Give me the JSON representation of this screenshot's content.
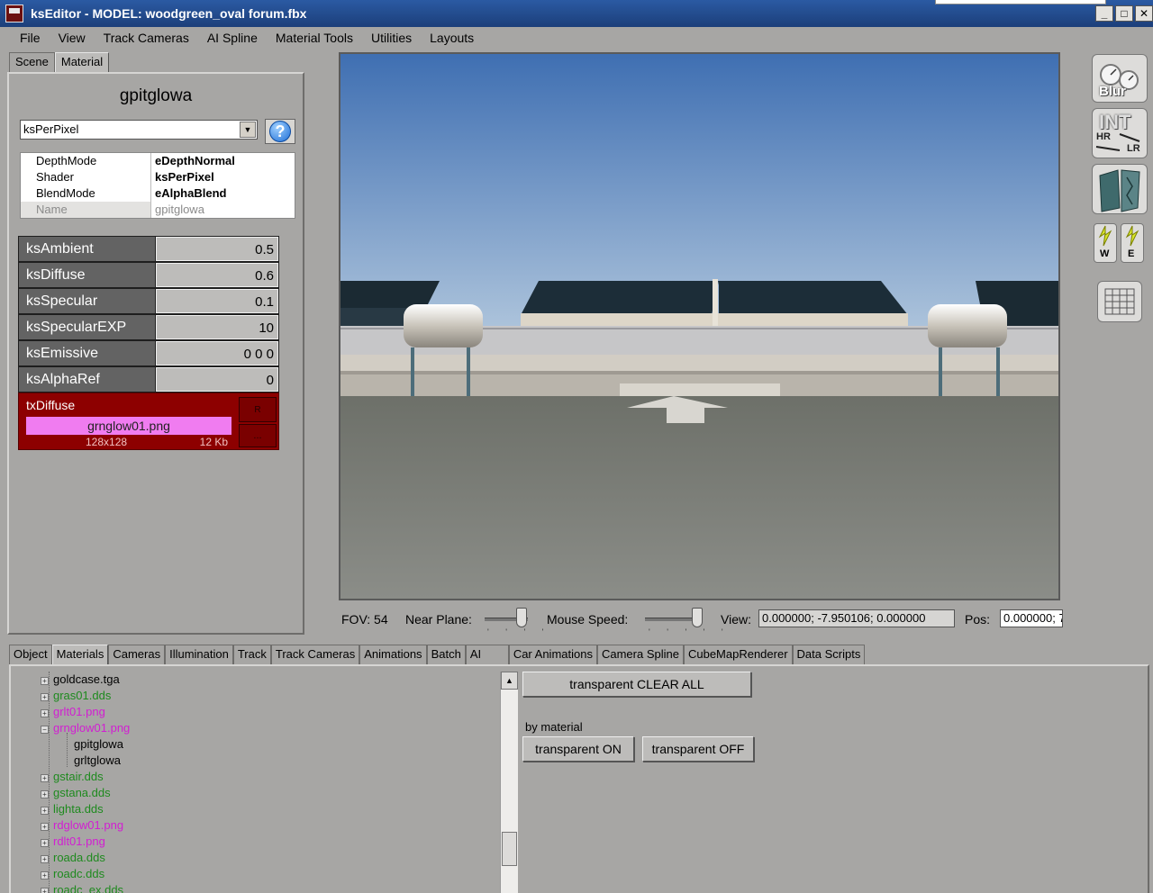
{
  "window": {
    "title": "ksEditor - MODEL: woodgreen_oval forum.fbx",
    "min": "_",
    "max": "□",
    "close": "✕"
  },
  "menu": [
    "File",
    "View",
    "Track Cameras",
    "AI Spline",
    "Material Tools",
    "Utilities",
    "Layouts"
  ],
  "left_tabs": [
    "Scene",
    "Material"
  ],
  "material": {
    "name": "gpitglowa",
    "shader_select": "ksPerPixel",
    "help": "?",
    "props": [
      {
        "key": "DepthMode",
        "value": "eDepthNormal"
      },
      {
        "key": "Shader",
        "value": "ksPerPixel"
      },
      {
        "key": "BlendMode",
        "value": "eAlphaBlend"
      },
      {
        "key": "Name",
        "value": "gpitglowa"
      }
    ],
    "params": [
      {
        "label": "ksAmbient",
        "value": "0.5"
      },
      {
        "label": "ksDiffuse",
        "value": "0.6"
      },
      {
        "label": "ksSpecular",
        "value": "0.1"
      },
      {
        "label": "ksSpecularEXP",
        "value": "10"
      },
      {
        "label": "ksEmissive",
        "value": "0 0 0"
      },
      {
        "label": "ksAlphaRef",
        "value": "0"
      }
    ],
    "texture": {
      "label": "txDiffuse",
      "file": "grnglow01.png",
      "size": "128x128",
      "kb": "12 Kb",
      "r_btn": "R",
      "dots_btn": "..."
    }
  },
  "right_tools": {
    "blur": "Blur",
    "int": "INT",
    "hr": "HR",
    "lr": "LR",
    "w": "W",
    "e": "E"
  },
  "status": {
    "fov": "FOV: 54",
    "near_plane": "Near Plane:",
    "near_plane_level": 0.85,
    "mouse_speed": "Mouse Speed:",
    "mouse_speed_level": 0.9,
    "view_label": "View:",
    "view_value": "0.000000; -7.950106; 0.000000",
    "pos_label": "Pos:",
    "pos_value": "0.000000; 7."
  },
  "bottom_tabs": [
    "Object",
    "Materials",
    "Cameras",
    "Illumination",
    "Track",
    "Track Cameras",
    "Animations",
    "Batch",
    "AI",
    "Car Animations",
    "Camera Spline",
    "CubeMapRenderer",
    "Data Scripts"
  ],
  "tree": [
    {
      "label": "goldcase.tga",
      "color": "black",
      "expander": "+"
    },
    {
      "label": "gras01.dds",
      "color": "green",
      "expander": "+"
    },
    {
      "label": "grlt01.png",
      "color": "magenta",
      "expander": "+"
    },
    {
      "label": "grnglow01.png",
      "color": "magenta",
      "expander": "−"
    },
    {
      "label": "gpitglowa",
      "color": "black",
      "child": true
    },
    {
      "label": "grltglowa",
      "color": "black",
      "child": true
    },
    {
      "label": "gstair.dds",
      "color": "green",
      "expander": "+"
    },
    {
      "label": "gstana.dds",
      "color": "green",
      "expander": "+"
    },
    {
      "label": "lighta.dds",
      "color": "green",
      "expander": "+"
    },
    {
      "label": "rdglow01.png",
      "color": "magenta",
      "expander": "+"
    },
    {
      "label": "rdlt01.png",
      "color": "magenta",
      "expander": "+"
    },
    {
      "label": "roada.dds",
      "color": "green",
      "expander": "+"
    },
    {
      "label": "roadc.dds",
      "color": "green",
      "expander": "+"
    },
    {
      "label": "roadc_ex.dds",
      "color": "green",
      "expander": "+"
    }
  ],
  "actions": {
    "clear_all": "transparent CLEAR ALL",
    "by_material": "by material",
    "on": "transparent ON",
    "off": "transparent OFF"
  },
  "colors": {
    "texture_bg": "#8d0000",
    "texture_file_bg": "#f07cf0",
    "tree_green": "#1e8a1e",
    "tree_magenta": "#d21ed2"
  }
}
